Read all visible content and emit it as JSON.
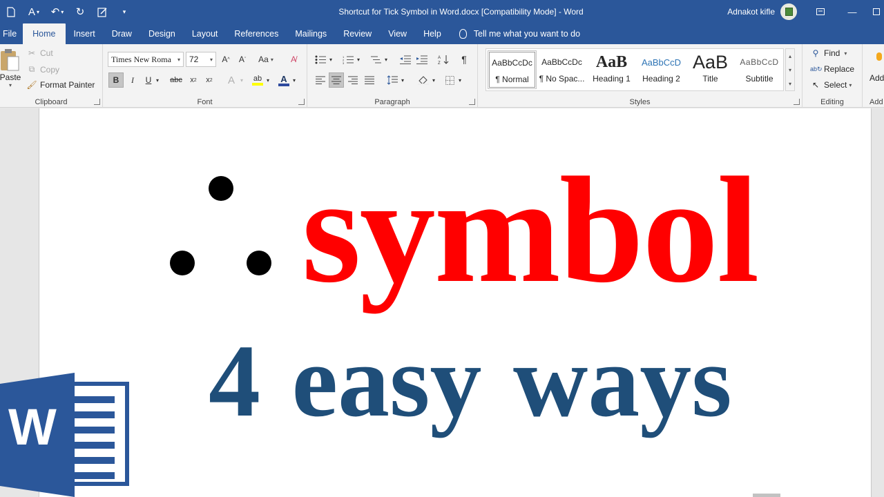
{
  "window": {
    "title": "Shortcut for Tick Symbol in Word.docx [Compatibility Mode]  -  Word",
    "user_name": "Adnakot kifle"
  },
  "tabs": [
    "File",
    "Home",
    "Insert",
    "Draw",
    "Design",
    "Layout",
    "References",
    "Mailings",
    "Review",
    "View",
    "Help"
  ],
  "tell_me": "Tell me what you want to do",
  "clipboard": {
    "paste": "Paste",
    "cut": "Cut",
    "copy": "Copy",
    "format_painter": "Format Painter",
    "label": "Clipboard"
  },
  "font": {
    "family": "Times New Roma",
    "size": "72",
    "label": "Font",
    "change_case": "Aa"
  },
  "paragraph": {
    "label": "Paragraph"
  },
  "styles": {
    "label": "Styles",
    "items": [
      {
        "sample": "AaBbCcDc",
        "name": "¶ Normal"
      },
      {
        "sample": "AaBbCcDc",
        "name": "¶ No Spac..."
      },
      {
        "sample": "AaB",
        "name": "Heading 1"
      },
      {
        "sample": "AaBbCcD",
        "name": "Heading 2"
      },
      {
        "sample": "AaB",
        "name": "Title"
      },
      {
        "sample": "AaBbCcD",
        "name": "Subtitle"
      }
    ]
  },
  "editing": {
    "label": "Editing",
    "find": "Find",
    "replace": "Replace",
    "select": "Select"
  },
  "addins": {
    "label_top": "Add",
    "label_bottom": "Add"
  },
  "document": {
    "line1": "symbol",
    "line2": "4 easy ways"
  },
  "colors": {
    "title_bar": "#2b579a",
    "red_text": "#ff0000",
    "blue_text": "#1f4e79"
  },
  "logo_letter": "W"
}
